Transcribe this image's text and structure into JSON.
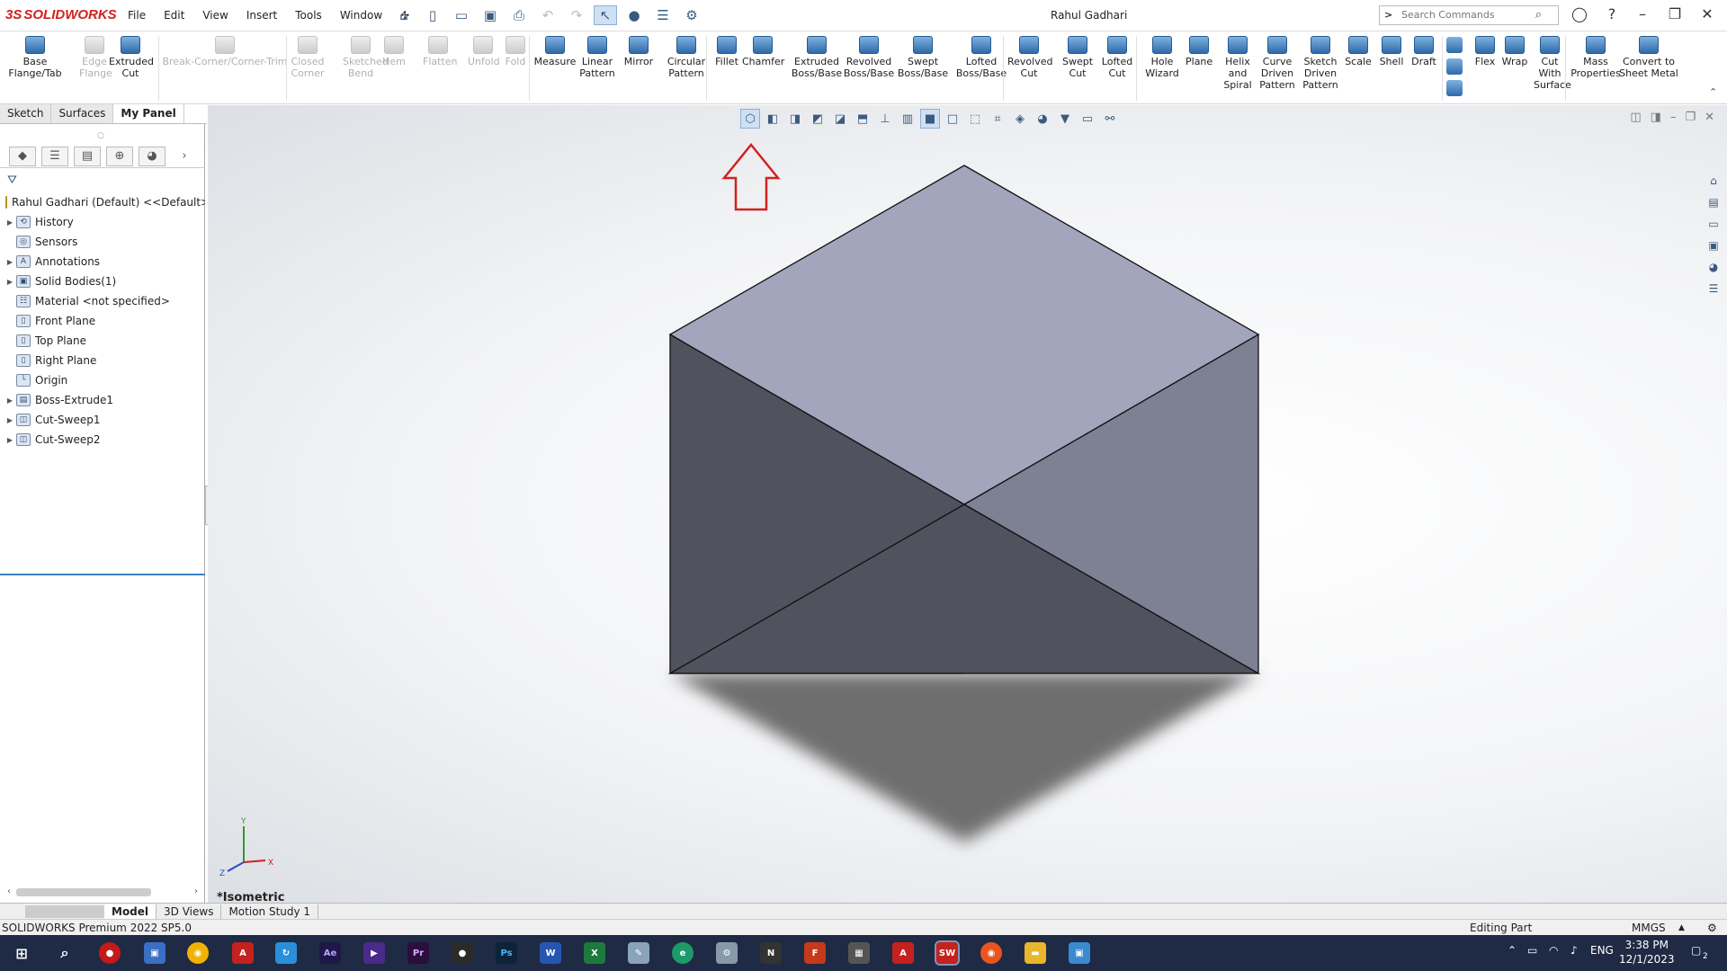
{
  "app": {
    "brand": "SOLIDWORKS",
    "window_title": "Rahul Gadhari",
    "menus": [
      "File",
      "Edit",
      "View",
      "Insert",
      "Tools",
      "Window"
    ],
    "search_placeholder": "Search Commands"
  },
  "ribbon": {
    "buttons": [
      {
        "label": "Base Flange/Tab",
        "enabled": true
      },
      {
        "label": "Edge Flange",
        "enabled": false
      },
      {
        "label": "Extruded Cut",
        "enabled": true
      },
      {
        "label": "Break-Corner/Corner-Trim",
        "enabled": false
      },
      {
        "label": "Closed Corner",
        "enabled": false
      },
      {
        "label": "Sketched Bend",
        "enabled": false
      },
      {
        "label": "Hem",
        "enabled": false
      },
      {
        "label": "Flatten",
        "enabled": false
      },
      {
        "label": "Unfold",
        "enabled": false
      },
      {
        "label": "Fold",
        "enabled": false
      },
      {
        "label": "Measure",
        "enabled": true
      },
      {
        "label": "Linear Pattern",
        "enabled": true
      },
      {
        "label": "Mirror",
        "enabled": true
      },
      {
        "label": "Circular Pattern",
        "enabled": true
      },
      {
        "label": "Fillet",
        "enabled": true
      },
      {
        "label": "Chamfer",
        "enabled": true
      },
      {
        "label": "Extruded Boss/Base",
        "enabled": true
      },
      {
        "label": "Revolved Boss/Base",
        "enabled": true
      },
      {
        "label": "Swept Boss/Base",
        "enabled": true
      },
      {
        "label": "Lofted Boss/Base",
        "enabled": true
      },
      {
        "label": "Revolved Cut",
        "enabled": true
      },
      {
        "label": "Swept Cut",
        "enabled": true
      },
      {
        "label": "Lofted Cut",
        "enabled": true
      },
      {
        "label": "Hole Wizard",
        "enabled": true
      },
      {
        "label": "Plane",
        "enabled": true
      },
      {
        "label": "Helix and Spiral",
        "enabled": true
      },
      {
        "label": "Curve Driven Pattern",
        "enabled": true
      },
      {
        "label": "Sketch Driven Pattern",
        "enabled": true
      },
      {
        "label": "Scale",
        "enabled": true
      },
      {
        "label": "Shell",
        "enabled": true
      },
      {
        "label": "Draft",
        "enabled": true
      },
      {
        "label": "Flex",
        "enabled": true
      },
      {
        "label": "Wrap",
        "enabled": true
      },
      {
        "label": "Cut With Surface",
        "enabled": true
      },
      {
        "label": "Mass Properties",
        "enabled": true
      },
      {
        "label": "Convert to Sheet Metal",
        "enabled": true
      }
    ]
  },
  "command_tabs": [
    "Sketch",
    "Surfaces",
    "My Panel"
  ],
  "active_command_tab": "My Panel",
  "feature_tree": {
    "root": "Rahul Gadhari (Default) <<Default>_D",
    "items": [
      {
        "label": "History",
        "expandable": true
      },
      {
        "label": "Sensors",
        "expandable": false
      },
      {
        "label": "Annotations",
        "expandable": true
      },
      {
        "label": "Solid Bodies(1)",
        "expandable": true
      },
      {
        "label": "Material <not specified>",
        "expandable": false
      },
      {
        "label": "Front Plane",
        "expandable": false
      },
      {
        "label": "Top Plane",
        "expandable": false
      },
      {
        "label": "Right Plane",
        "expandable": false
      },
      {
        "label": "Origin",
        "expandable": false
      },
      {
        "label": "Boss-Extrude1",
        "expandable": true
      },
      {
        "label": "Cut-Sweep1",
        "expandable": true
      },
      {
        "label": "Cut-Sweep2",
        "expandable": true
      }
    ]
  },
  "viewport": {
    "view_name": "*Isometric",
    "triad": {
      "x": "X",
      "y": "Y",
      "z": "Z"
    },
    "face_colors": {
      "top": "#a2a5bb",
      "left": "#50525e",
      "right": "#7e8094",
      "shadow": "#6e6e6e"
    },
    "annotation_arrow_color": "#d0221e"
  },
  "bottom_tabs": [
    "Model",
    "3D Views",
    "Motion Study 1"
  ],
  "active_bottom_tab": "Model",
  "status": {
    "version": "SOLIDWORKS Premium 2022 SP5.0",
    "mode": "Editing Part",
    "units": "MMGS"
  },
  "taskbar": {
    "language": "ENG",
    "time": "3:38 PM",
    "date": "12/1/2023",
    "notification_count": "2"
  }
}
